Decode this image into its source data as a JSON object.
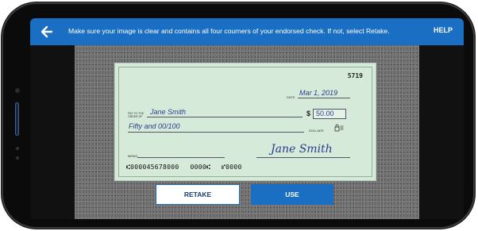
{
  "header": {
    "instruction": "Make sure your image is clear and contains all four courners of your endorsed check. If not, select Retake.",
    "help_label": "HELP",
    "back_icon": "arrow-left-icon"
  },
  "check": {
    "number": "5719",
    "date_label": "DATE",
    "date": "Mar 1, 2019",
    "pay_to_label": "PAY TO THE ORDER OF",
    "payee": "Jane Smith",
    "amount_symbol": "$",
    "amount": "50.00",
    "amount_words": "Fifty and 00/100",
    "dollars_label": "DOLLARS",
    "memo_label": "MEMO",
    "signature": "Jane Smith",
    "micr_routing": "⑆000045678000",
    "micr_account": "0000⑆",
    "micr_check": "⑈0000"
  },
  "actions": {
    "retake_label": "RETAKE",
    "use_label": "USE"
  },
  "colors": {
    "accent": "#1a6fc2",
    "check_paper": "#d6ead9",
    "ink": "#2a3d8c"
  }
}
